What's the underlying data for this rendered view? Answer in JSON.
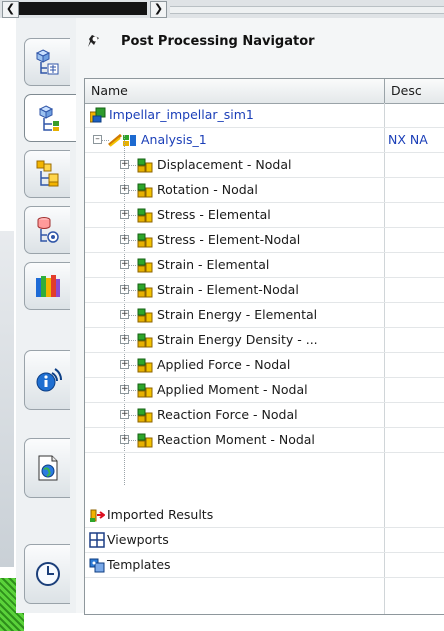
{
  "panel": {
    "title": "Post Processing Navigator",
    "columns": {
      "name": "Name",
      "description": "Desc"
    }
  },
  "tree": {
    "root": {
      "label": "Impellar_impellar_sim1"
    },
    "analysis": {
      "label": "Analysis_1",
      "description": "NX NA"
    },
    "results": [
      {
        "label": "Displacement - Nodal"
      },
      {
        "label": "Rotation - Nodal"
      },
      {
        "label": "Stress - Elemental"
      },
      {
        "label": "Stress - Element-Nodal"
      },
      {
        "label": "Strain - Elemental"
      },
      {
        "label": "Strain - Element-Nodal"
      },
      {
        "label": "Strain Energy - Elemental"
      },
      {
        "label": "Strain Energy Density - ..."
      },
      {
        "label": "Applied Force - Nodal"
      },
      {
        "label": "Applied Moment - Nodal"
      },
      {
        "label": "Reaction Force - Nodal"
      },
      {
        "label": "Reaction Moment - Nodal"
      }
    ],
    "bottom": [
      {
        "label": "Imported Results",
        "icon": "imported-results-icon"
      },
      {
        "label": "Viewports",
        "icon": "viewports-icon"
      },
      {
        "label": "Templates",
        "icon": "templates-icon"
      }
    ]
  },
  "resource_bar": {
    "tabs": [
      {
        "name": "assembly-navigator-tab",
        "icon": "assembly-navigator-icon"
      },
      {
        "name": "sim-navigator-tab",
        "icon": "sim-navigator-icon",
        "active": true
      },
      {
        "name": "part-navigator-tab",
        "icon": "part-navigator-icon"
      },
      {
        "name": "constraint-navigator-tab",
        "icon": "constraint-navigator-icon"
      },
      {
        "name": "reuse-library-tab",
        "icon": "reuse-library-icon"
      },
      {
        "name": "roles-tab",
        "icon": "roles-icon"
      },
      {
        "name": "web-browser-tab",
        "icon": "web-browser-icon"
      },
      {
        "name": "history-tab",
        "icon": "history-icon"
      }
    ]
  },
  "colors": {
    "link": "#1b3fb8",
    "result_icon_yellow": "#e8b400",
    "result_icon_green": "#39a52a"
  }
}
